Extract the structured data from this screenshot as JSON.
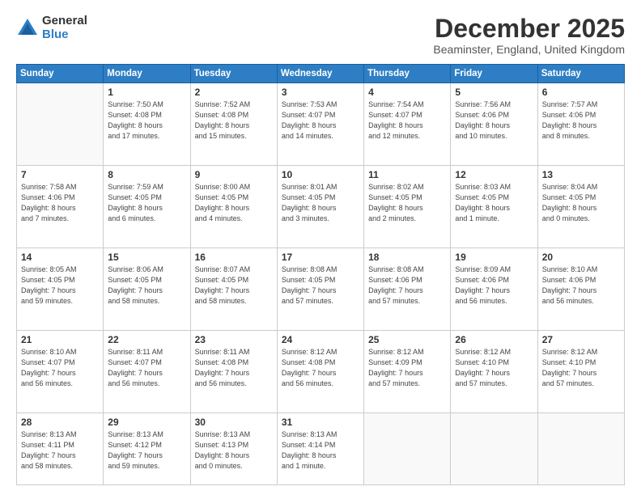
{
  "logo": {
    "general": "General",
    "blue": "Blue"
  },
  "header": {
    "month": "December 2025",
    "location": "Beaminster, England, United Kingdom"
  },
  "weekdays": [
    "Sunday",
    "Monday",
    "Tuesday",
    "Wednesday",
    "Thursday",
    "Friday",
    "Saturday"
  ],
  "weeks": [
    [
      {
        "day": "",
        "info": ""
      },
      {
        "day": "1",
        "info": "Sunrise: 7:50 AM\nSunset: 4:08 PM\nDaylight: 8 hours\nand 17 minutes."
      },
      {
        "day": "2",
        "info": "Sunrise: 7:52 AM\nSunset: 4:08 PM\nDaylight: 8 hours\nand 15 minutes."
      },
      {
        "day": "3",
        "info": "Sunrise: 7:53 AM\nSunset: 4:07 PM\nDaylight: 8 hours\nand 14 minutes."
      },
      {
        "day": "4",
        "info": "Sunrise: 7:54 AM\nSunset: 4:07 PM\nDaylight: 8 hours\nand 12 minutes."
      },
      {
        "day": "5",
        "info": "Sunrise: 7:56 AM\nSunset: 4:06 PM\nDaylight: 8 hours\nand 10 minutes."
      },
      {
        "day": "6",
        "info": "Sunrise: 7:57 AM\nSunset: 4:06 PM\nDaylight: 8 hours\nand 8 minutes."
      }
    ],
    [
      {
        "day": "7",
        "info": "Sunrise: 7:58 AM\nSunset: 4:06 PM\nDaylight: 8 hours\nand 7 minutes."
      },
      {
        "day": "8",
        "info": "Sunrise: 7:59 AM\nSunset: 4:05 PM\nDaylight: 8 hours\nand 6 minutes."
      },
      {
        "day": "9",
        "info": "Sunrise: 8:00 AM\nSunset: 4:05 PM\nDaylight: 8 hours\nand 4 minutes."
      },
      {
        "day": "10",
        "info": "Sunrise: 8:01 AM\nSunset: 4:05 PM\nDaylight: 8 hours\nand 3 minutes."
      },
      {
        "day": "11",
        "info": "Sunrise: 8:02 AM\nSunset: 4:05 PM\nDaylight: 8 hours\nand 2 minutes."
      },
      {
        "day": "12",
        "info": "Sunrise: 8:03 AM\nSunset: 4:05 PM\nDaylight: 8 hours\nand 1 minute."
      },
      {
        "day": "13",
        "info": "Sunrise: 8:04 AM\nSunset: 4:05 PM\nDaylight: 8 hours\nand 0 minutes."
      }
    ],
    [
      {
        "day": "14",
        "info": "Sunrise: 8:05 AM\nSunset: 4:05 PM\nDaylight: 7 hours\nand 59 minutes."
      },
      {
        "day": "15",
        "info": "Sunrise: 8:06 AM\nSunset: 4:05 PM\nDaylight: 7 hours\nand 58 minutes."
      },
      {
        "day": "16",
        "info": "Sunrise: 8:07 AM\nSunset: 4:05 PM\nDaylight: 7 hours\nand 58 minutes."
      },
      {
        "day": "17",
        "info": "Sunrise: 8:08 AM\nSunset: 4:05 PM\nDaylight: 7 hours\nand 57 minutes."
      },
      {
        "day": "18",
        "info": "Sunrise: 8:08 AM\nSunset: 4:06 PM\nDaylight: 7 hours\nand 57 minutes."
      },
      {
        "day": "19",
        "info": "Sunrise: 8:09 AM\nSunset: 4:06 PM\nDaylight: 7 hours\nand 56 minutes."
      },
      {
        "day": "20",
        "info": "Sunrise: 8:10 AM\nSunset: 4:06 PM\nDaylight: 7 hours\nand 56 minutes."
      }
    ],
    [
      {
        "day": "21",
        "info": "Sunrise: 8:10 AM\nSunset: 4:07 PM\nDaylight: 7 hours\nand 56 minutes."
      },
      {
        "day": "22",
        "info": "Sunrise: 8:11 AM\nSunset: 4:07 PM\nDaylight: 7 hours\nand 56 minutes."
      },
      {
        "day": "23",
        "info": "Sunrise: 8:11 AM\nSunset: 4:08 PM\nDaylight: 7 hours\nand 56 minutes."
      },
      {
        "day": "24",
        "info": "Sunrise: 8:12 AM\nSunset: 4:08 PM\nDaylight: 7 hours\nand 56 minutes."
      },
      {
        "day": "25",
        "info": "Sunrise: 8:12 AM\nSunset: 4:09 PM\nDaylight: 7 hours\nand 57 minutes."
      },
      {
        "day": "26",
        "info": "Sunrise: 8:12 AM\nSunset: 4:10 PM\nDaylight: 7 hours\nand 57 minutes."
      },
      {
        "day": "27",
        "info": "Sunrise: 8:12 AM\nSunset: 4:10 PM\nDaylight: 7 hours\nand 57 minutes."
      }
    ],
    [
      {
        "day": "28",
        "info": "Sunrise: 8:13 AM\nSunset: 4:11 PM\nDaylight: 7 hours\nand 58 minutes."
      },
      {
        "day": "29",
        "info": "Sunrise: 8:13 AM\nSunset: 4:12 PM\nDaylight: 7 hours\nand 59 minutes."
      },
      {
        "day": "30",
        "info": "Sunrise: 8:13 AM\nSunset: 4:13 PM\nDaylight: 8 hours\nand 0 minutes."
      },
      {
        "day": "31",
        "info": "Sunrise: 8:13 AM\nSunset: 4:14 PM\nDaylight: 8 hours\nand 1 minute."
      },
      {
        "day": "",
        "info": ""
      },
      {
        "day": "",
        "info": ""
      },
      {
        "day": "",
        "info": ""
      }
    ]
  ]
}
